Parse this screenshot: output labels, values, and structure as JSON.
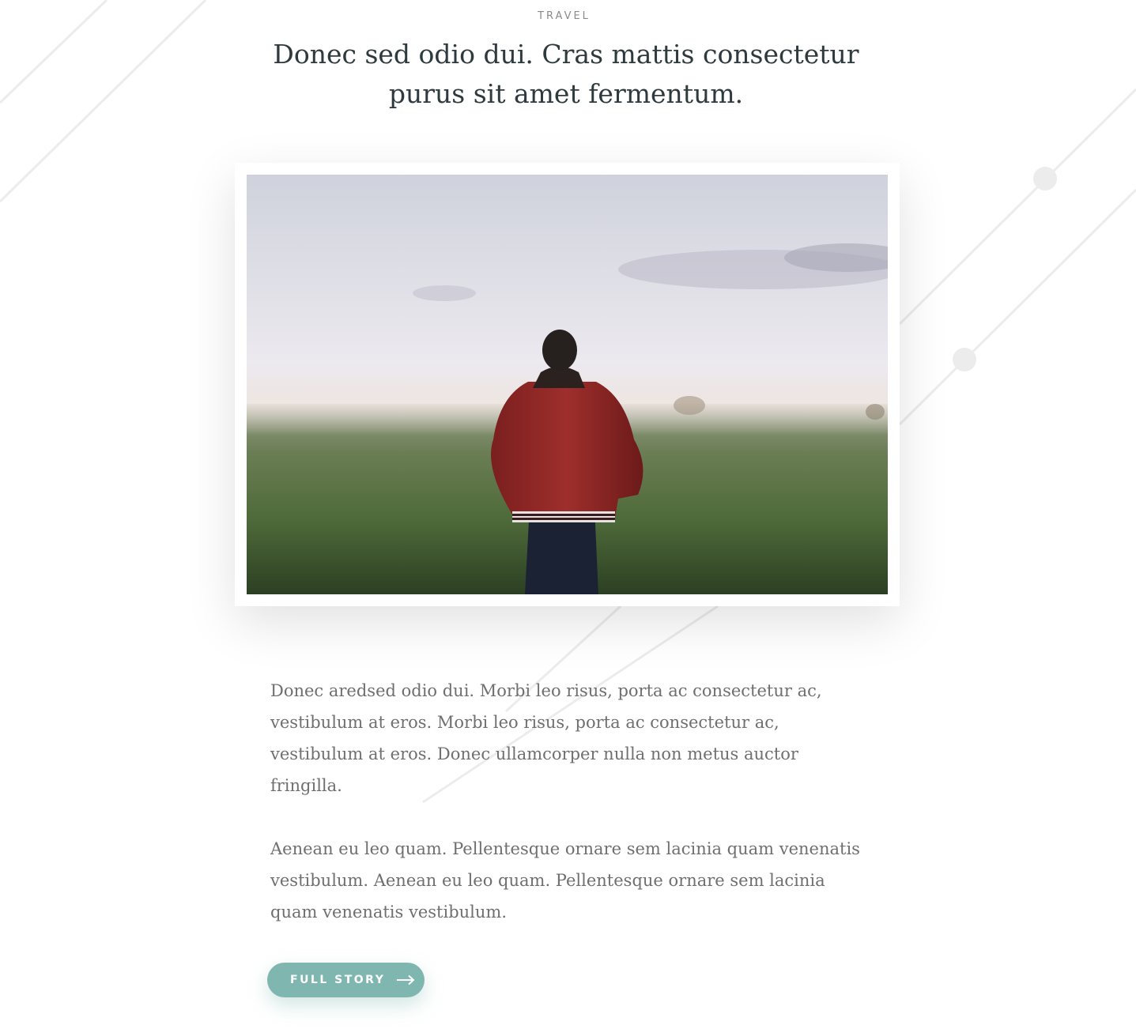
{
  "post": {
    "category": "TRAVEL",
    "title": "Donec sed odio dui. Cras mattis consectetur purus sit amet fermentum.",
    "paragraphs": [
      "Donec aredsed odio dui. Morbi leo risus, porta ac consectetur ac, vestibulum at eros. Morbi leo risus, porta ac consectetur ac, vestibulum at eros. Donec ullamcorper nulla non metus auctor fringilla.",
      "Aenean eu leo quam. Pellentesque ornare sem lacinia quam venenatis vestibulum. Aenean eu leo quam. Pellentesque ornare sem lacinia quam venenatis vestibulum."
    ],
    "cta_label": "FULL STORY",
    "cta_icon": "arrow-right-icon",
    "image_icon": "man-in-red-jacket-field-photo"
  },
  "colors": {
    "accent": "#7fb7b0",
    "title": "#2e3a3e",
    "body": "#6f6f6f",
    "category": "#8a8a8a",
    "decor_lines": "#ececec"
  }
}
